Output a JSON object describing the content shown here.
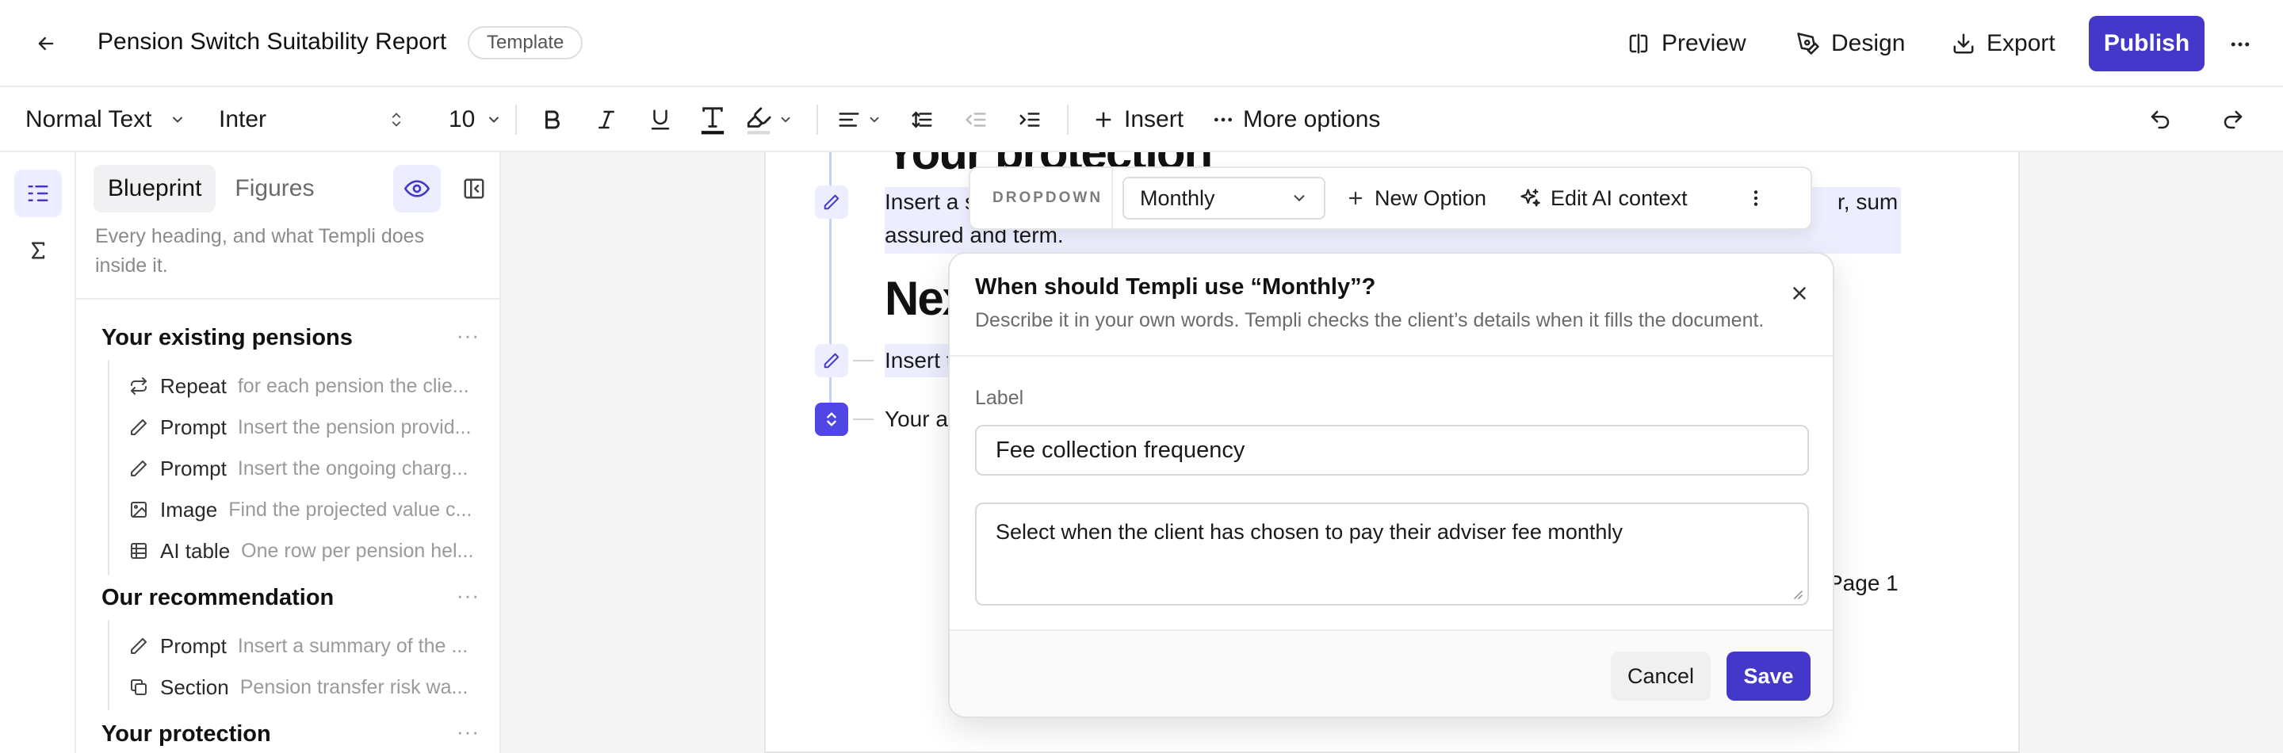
{
  "header": {
    "title": "Pension Switch Suitability Report",
    "badge": "Template",
    "preview_label": "Preview",
    "design_label": "Design",
    "export_label": "Export",
    "publish_label": "Publish"
  },
  "toolbar": {
    "text_style": "Normal Text",
    "font": "Inter",
    "font_size": "10",
    "insert_label": "Insert",
    "more_options_label": "More options"
  },
  "panel": {
    "tabs": [
      "Blueprint",
      "Figures"
    ],
    "description": "Every heading, and what Templi does inside it.",
    "sections": [
      {
        "title": "Your existing pensions",
        "items": [
          {
            "kind": "Repeat",
            "desc": "for each pension the clie...",
            "icon": "repeat-icon"
          },
          {
            "kind": "Prompt",
            "desc": "Insert the pension provid...",
            "icon": "pen-icon"
          },
          {
            "kind": "Prompt",
            "desc": "Insert the ongoing charg...",
            "icon": "pen-icon"
          },
          {
            "kind": "Image",
            "desc": "Find the projected value c...",
            "icon": "image-icon"
          },
          {
            "kind": "AI table",
            "desc": "One row per pension hel...",
            "icon": "table-icon"
          }
        ]
      },
      {
        "title": "Our recommendation",
        "items": [
          {
            "kind": "Prompt",
            "desc": "Insert a summary of the ...",
            "icon": "pen-icon"
          },
          {
            "kind": "Section",
            "desc": "Pension transfer risk wa...",
            "icon": "copy-icon"
          }
        ]
      },
      {
        "title": "Your protection",
        "items": []
      }
    ]
  },
  "doc": {
    "heading_protection": "Your protection",
    "para1_line1": "Insert a s",
    "para1_line1_right": "r, sum",
    "para1_line2": "assured and term.",
    "heading_next": "Nex",
    "para2": "Insert t",
    "para3": "Your a",
    "page_label": "Page 1"
  },
  "bubble": {
    "tag": "DROPDOWN",
    "selected": "Monthly",
    "new_option_label": "New Option",
    "edit_ai_label": "Edit AI context"
  },
  "modal": {
    "title": "When should Templi use “Monthly”?",
    "subtitle": "Describe it in your own words. Templi checks the client’s details when it fills the document.",
    "label_caption": "Label",
    "label_value": "Fee collection frequency",
    "context_value": "Select when the client has chosen to pay their adviser fee monthly",
    "cancel_label": "Cancel",
    "save_label": "Save"
  },
  "colors": {
    "accent": "#4338ca",
    "accent_light": "#eceeff",
    "border": "#ececec"
  }
}
